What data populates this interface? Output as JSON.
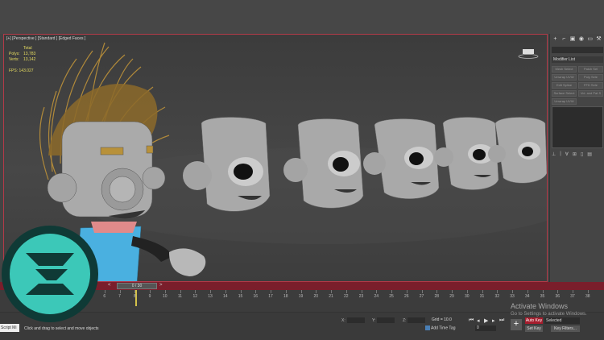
{
  "viewport": {
    "label": "[+] [Perspective ] [Standard ] [Edged Faces ]",
    "stats": {
      "total_label": "Total",
      "polys_label": "Polys:",
      "polys_value": "13,783",
      "verts_label": "Verts:",
      "verts_value": "13,142",
      "fps_label": "FPS:",
      "fps_value": "143.027"
    }
  },
  "command_panel": {
    "tabs": [
      "+",
      "⌐",
      "▣",
      "◉",
      "▭",
      "⚒"
    ],
    "modifier_list": "Modifier List",
    "modifier_buttons": [
      "Mesh Select",
      "Patch Sel",
      "Unwrap UVW",
      "Poly Sele",
      "Edit Spline",
      "FFD Sele",
      "Surface Select",
      "Vol. and Pat S",
      "Unwrap UVW"
    ],
    "stack_tools": [
      "⊥",
      "|",
      "∀",
      "⊞",
      "▯",
      "▤"
    ]
  },
  "timeline": {
    "slider_text": "0 / 30",
    "prev_arrow": "<",
    "next_arrow": ">",
    "ruler_ticks": [
      "5",
      "6",
      "7",
      "8",
      "9",
      "10",
      "11",
      "12",
      "13",
      "14",
      "15",
      "16",
      "17",
      "18",
      "19",
      "20",
      "21",
      "22",
      "23",
      "24",
      "25",
      "26",
      "27",
      "28",
      "29",
      "30",
      "31",
      "32",
      "33",
      "34",
      "35",
      "36",
      "37",
      "38"
    ]
  },
  "status_bar": {
    "maxscript_label": "Script Mi",
    "prompt": "Click and drag to select and move objects",
    "x_label": "X:",
    "y_label": "Y:",
    "z_label": "Z:",
    "grid": "Grid = 10.0",
    "add_time_tag": "Add Time Tag",
    "current_frame": "0",
    "auto_key": "Auto Key",
    "set_key": "Set Key",
    "selected": "Selected",
    "key_filters": "Key Filters...",
    "playback": [
      "⏮",
      "◂",
      "▶",
      "▸",
      "⏭"
    ]
  },
  "watermark": {
    "title": "Activate Windows",
    "subtitle": "Go to Settings to activate Windows."
  },
  "colors": {
    "accent_red": "#a51d2d",
    "stats_yellow": "#e6dc60",
    "logo_teal": "#3cc8b8",
    "logo_dark": "#0f3a36"
  }
}
